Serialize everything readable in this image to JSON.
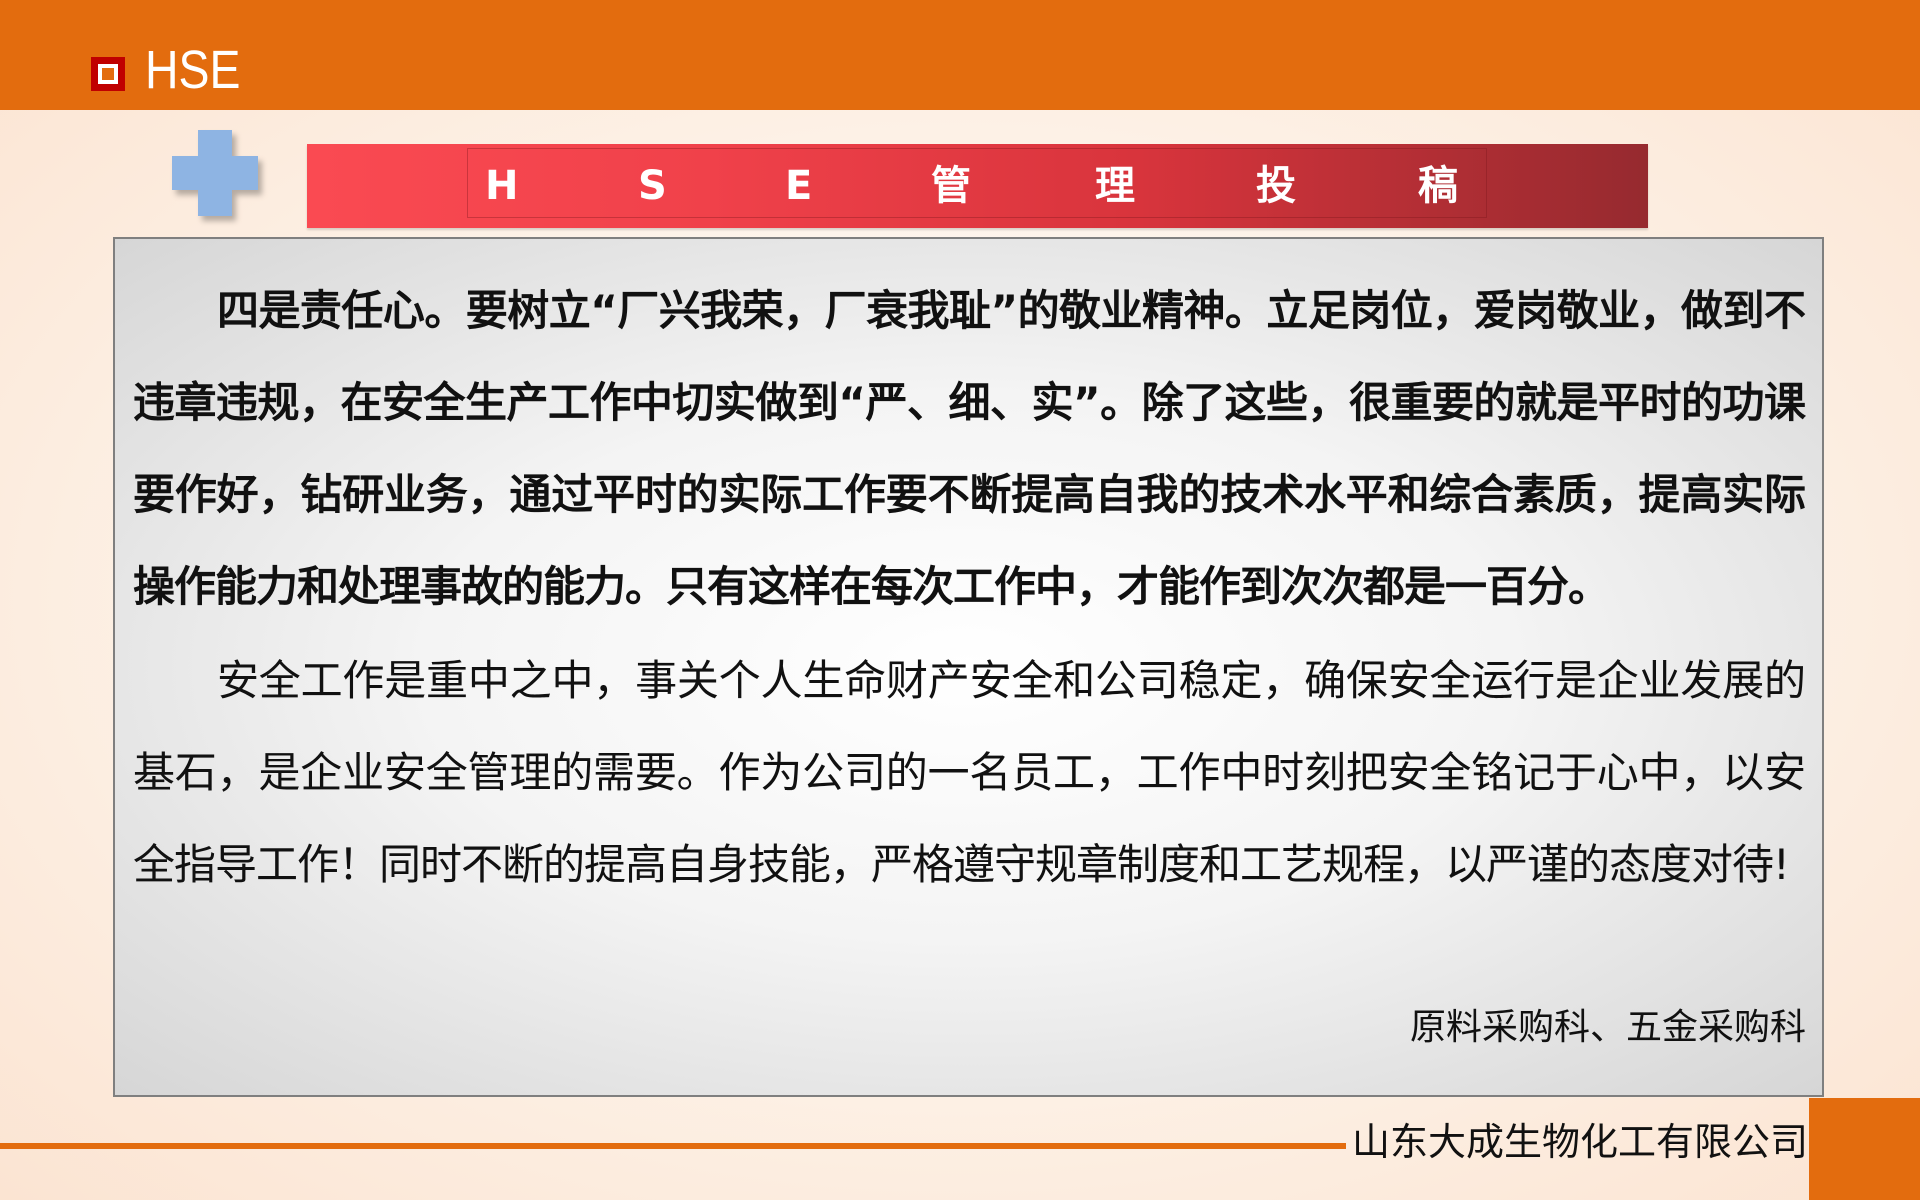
{
  "header": {
    "brand": "HSE",
    "bar_color": "#e36c0e",
    "icon": "square-outline-icon"
  },
  "title_banner": {
    "chars": [
      "H",
      "S",
      "E",
      "管",
      "理",
      "投",
      "稿"
    ],
    "decoration": "cross-icon"
  },
  "content": {
    "paragraph_1": "四是责任心。要树立“厂兴我荣，厂衰我耻”的敬业精神。立足岗位，爱岗敬业，做到不违章违规，在安全生产工作中切实做到“严、细、实”。除了这些，很重要的就是平时的功课要作好，钻研业务，通过平时的实际工作要不断提高自我的技术水平和综合素质，提高实际操作能力和处理事故的能力。只有这样在每次工作中，才能作到次次都是一百分。",
    "paragraph_2": "安全工作是重中之中，事关个人生命财产安全和公司稳定，确保安全运行是企业发展的基石，是企业安全管理的需要。作为公司的一名员工，工作中时刻把安全铭记于心中，以安全指导工作！同时不断的提高自身技能，严格遵守规章制度和工艺规程，以严谨的态度对待!",
    "signature": "原料采购科、五金采购科"
  },
  "footer": {
    "company": "山东大成生物化工有限公司"
  }
}
